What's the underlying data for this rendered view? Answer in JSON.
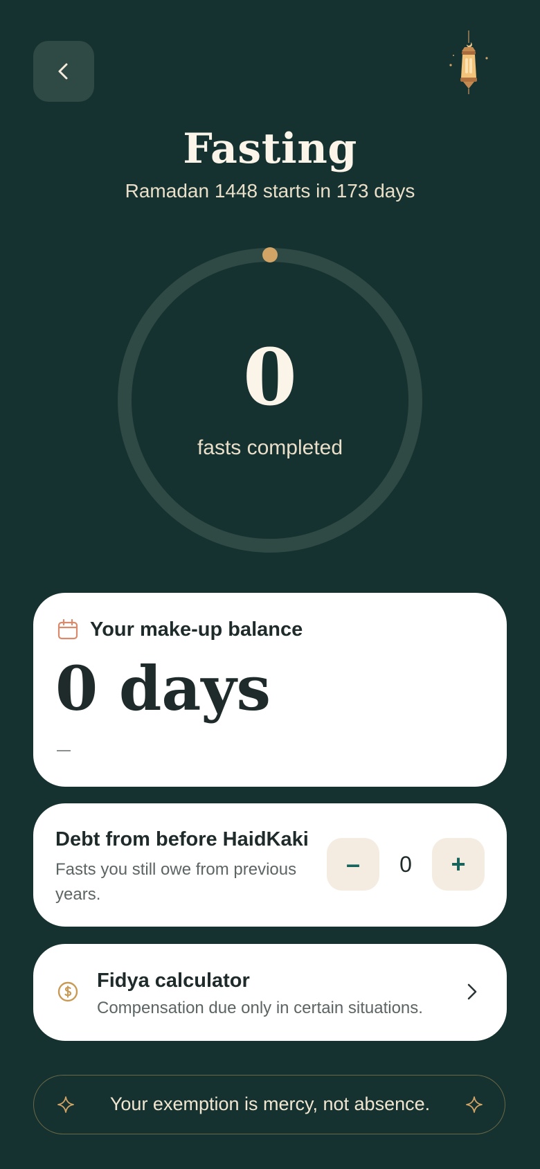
{
  "header": {
    "title": "Fasting",
    "subtitle": "Ramadan 1448 starts in 173 days",
    "back_icon": "chevron-left-icon",
    "decor_icon": "lantern-icon"
  },
  "progress": {
    "count": "0",
    "caption": "fasts completed",
    "fraction": 0
  },
  "balance_card": {
    "icon": "calendar-icon",
    "label": "Your make-up balance",
    "value": "0 days"
  },
  "debt_card": {
    "title": "Debt from before HaidKaki",
    "description": "Fasts you still owe from previous years.",
    "value": "0",
    "minus_label": "–",
    "plus_label": "+"
  },
  "fidya_card": {
    "icon": "coin-icon",
    "title": "Fidya calculator",
    "description": "Compensation due only in certain situations."
  },
  "footer": {
    "message": "Your exemption is mercy, not absence."
  },
  "colors": {
    "background": "#153130",
    "accent_gold": "#d2a566",
    "card": "#ffffff",
    "teal": "#16645c",
    "ring_track": "#2f4945"
  }
}
